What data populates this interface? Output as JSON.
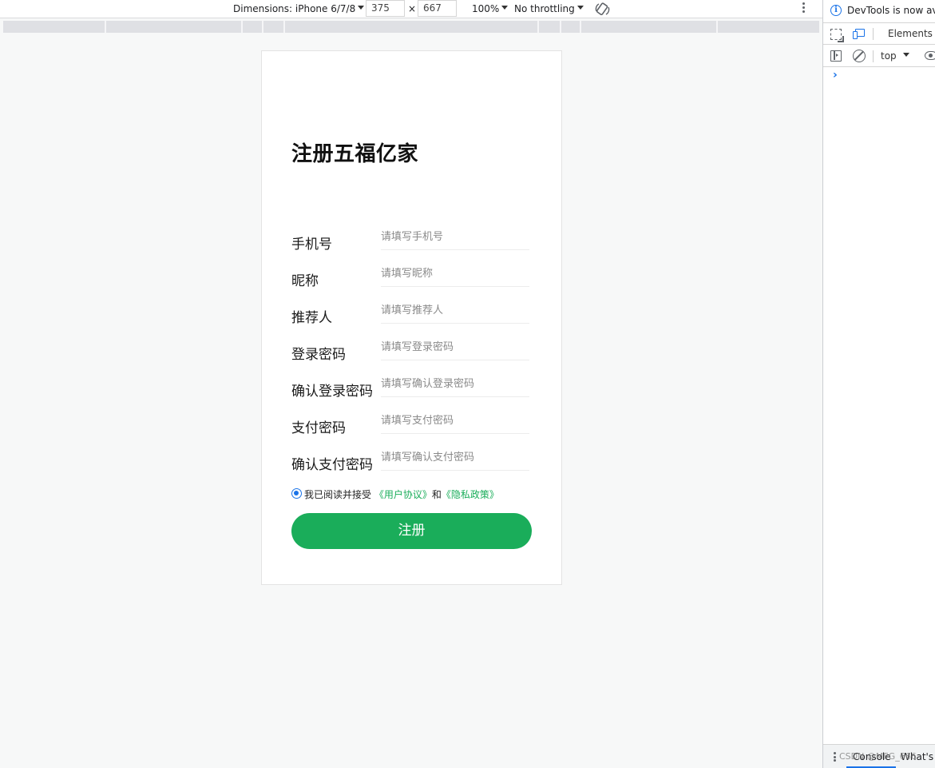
{
  "device_toolbar": {
    "dimensions_label": "Dimensions: iPhone 6/7/8",
    "width_value": "375",
    "times": "×",
    "height_value": "667",
    "zoom": "100%",
    "throttling": "No throttling"
  },
  "phone": {
    "title": "注册五福亿家",
    "fields": [
      {
        "label": "手机号",
        "placeholder": "请填写手机号"
      },
      {
        "label": "昵称",
        "placeholder": "请填写昵称"
      },
      {
        "label": "推荐人",
        "placeholder": "请填写推荐人"
      },
      {
        "label": "登录密码",
        "placeholder": "请填写登录密码"
      },
      {
        "label": "确认登录密码",
        "placeholder": "请填写确认登录密码"
      },
      {
        "label": "支付密码",
        "placeholder": "请填写支付密码"
      },
      {
        "label": "确认支付密码",
        "placeholder": "请填写确认支付密码"
      }
    ],
    "agreement": {
      "prefix": "我已阅读并接受",
      "user_agreement": "《用户协议》",
      "and": "和",
      "privacy_policy": "《隐私政策》"
    },
    "submit_label": "注册",
    "accent_color": "#1aad5a"
  },
  "devtools": {
    "banner_text": "DevTools is now available",
    "tab_elements": "Elements",
    "context": "top",
    "prompt": "›",
    "drawer": {
      "console": "Console",
      "whats_new": "What's"
    },
    "watermark": "CSDN @MFG_666"
  }
}
